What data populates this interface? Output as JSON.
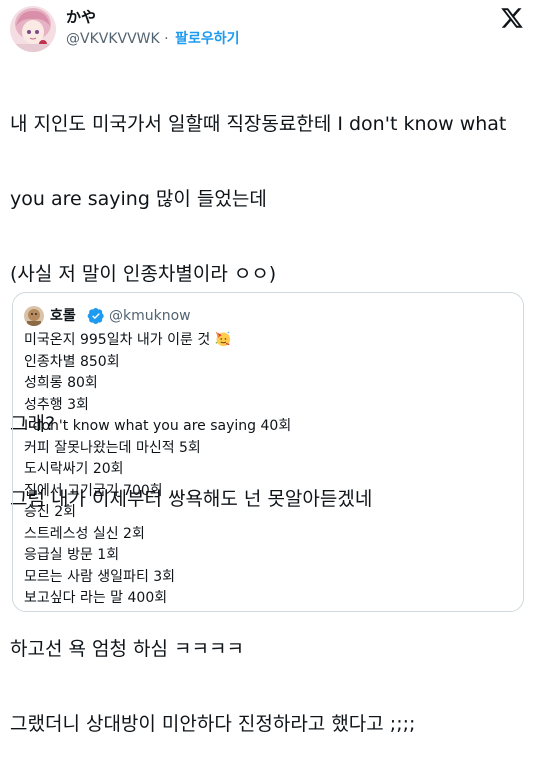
{
  "author": {
    "display_name": "かや",
    "handle": "@VKVKVVWK",
    "separator": "·",
    "follow_label": "팔로우하기"
  },
  "platform_icon": "x-logo-icon",
  "tweet": {
    "lines": [
      "내 지인도 미국가서 일할때 직장동료한테 I don't know what",
      "you are saying 많이 들었는데",
      "(사실 저 말이 인종차별이라 ㅇㅇ)",
      "",
      "그래?",
      "그럼 내가 이제부터 쌍욕해도 넌 못알아듣겠네",
      "",
      "하고선 욕 엄청 하심 ㅋㅋㅋㅋ",
      "그랬더니 상대방이 미안하다 진정하라고 했다고 ;;;;"
    ]
  },
  "quoted_tweet": {
    "display_name": "호롤",
    "verified_icon": "verified-badge-icon",
    "handle": "@kmuknow",
    "emoji": "party-face-icon",
    "lines": [
      "미국온지 995일차 내가 이룬 것",
      "인종차별 850회",
      "성희롱 80회",
      "성추행 3회",
      "I don't know what you are saying 40회",
      "커피 잘못나왔는데 마신적 5회",
      "도시락싸기 20회",
      "집에서 고기굽기 700회",
      "승진 2회",
      "스트레스성 실신 2회",
      "응급실 방문 1회",
      "모르는 사람 생일파티 3회",
      "보고싶다 라는 말 400회"
    ]
  },
  "colors": {
    "text": "#0f1419",
    "secondary": "#536471",
    "accent": "#1d9bf0",
    "border": "#cfd9de"
  }
}
